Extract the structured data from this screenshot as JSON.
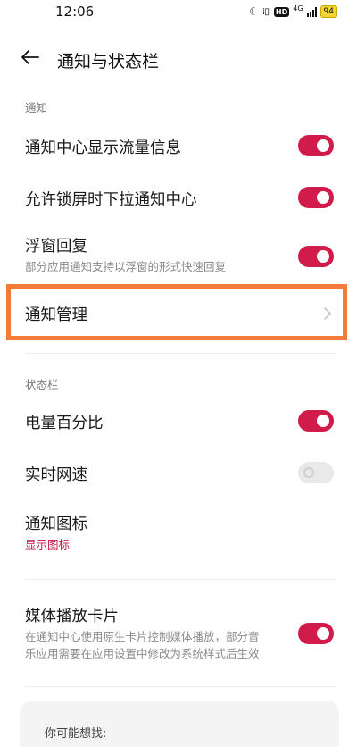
{
  "status_bar": {
    "time": "12:06",
    "icons": [
      "moon-icon",
      "vibrate-icon",
      "hd-icon",
      "4g-signal-icon",
      "battery-icon"
    ],
    "hd": "HD",
    "net": "4G",
    "battery": "94"
  },
  "header": {
    "title": "通知与状态栏"
  },
  "sections": {
    "notification": "通知",
    "status_bar": "状态栏"
  },
  "rows": {
    "flow_info": {
      "title": "通知中心显示流量信息",
      "enabled": true
    },
    "lockscreen_pull": {
      "title": "允许锁屏时下拉通知中心",
      "enabled": true
    },
    "float_reply": {
      "title": "浮窗回复",
      "subtitle": "部分应用通知支持以浮窗的形式快速回复",
      "enabled": true
    },
    "notification_manage": {
      "title": "通知管理"
    },
    "battery_percent": {
      "title": "电量百分比",
      "enabled": true
    },
    "realtime_speed": {
      "title": "实时网速",
      "enabled": false
    },
    "notification_icon": {
      "title": "通知图标",
      "subtitle": "显示图标"
    },
    "media_card": {
      "title": "媒体播放卡片",
      "subtitle_line1": "在通知中心使用原生卡片控制媒体播放，部分音",
      "subtitle_line2": "乐应用需要在应用设置中修改为系统样式后生效",
      "enabled": true
    }
  },
  "suggest": {
    "label": "你可能想找:"
  },
  "colors": {
    "accent": "#d01b4b",
    "highlight": "#f47a3a",
    "toggle_off": "#e9e9e9"
  }
}
